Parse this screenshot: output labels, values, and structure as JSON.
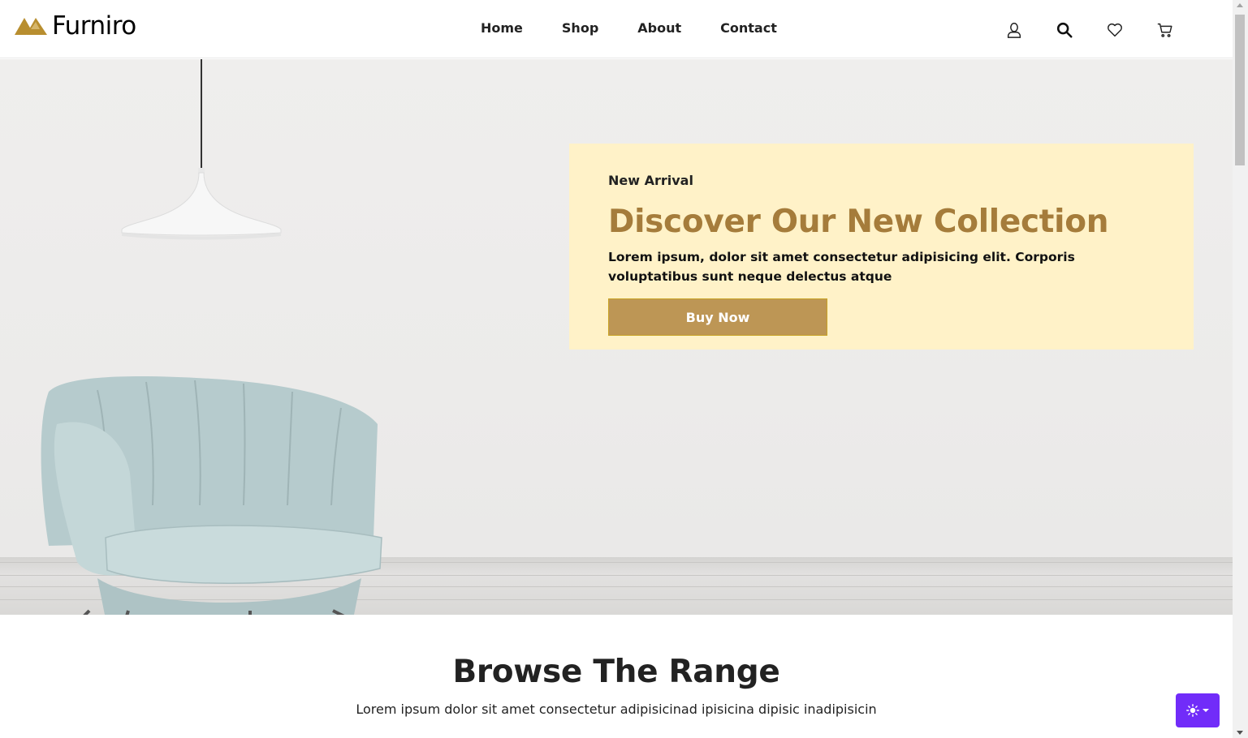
{
  "brand": {
    "name": "Furniro",
    "accent": "#b88e2f"
  },
  "nav": {
    "items": [
      {
        "label": "Home"
      },
      {
        "label": "Shop"
      },
      {
        "label": "About"
      },
      {
        "label": "Contact"
      }
    ]
  },
  "header_icons": [
    "user-icon",
    "search-icon",
    "heart-icon",
    "cart-icon"
  ],
  "hero": {
    "label": "New Arrival",
    "title": "Discover Our New Collection",
    "description": "Lorem ipsum, dolor sit amet consectetur adipisicing elit. Corporis voluptatibus sunt neque delectus atque",
    "button_label": "Buy Now",
    "box_color": "#fff3c8",
    "title_color": "#a57c3b",
    "button_color": "#bd9655"
  },
  "browse": {
    "title": "Browse The Range",
    "subtitle": "Lorem ipsum dolor sit amet consectetur adipisicinad ipisicina dipisic inadipisicin"
  },
  "theme_toggle": {
    "icon": "sun-icon",
    "color": "#712cf9"
  }
}
